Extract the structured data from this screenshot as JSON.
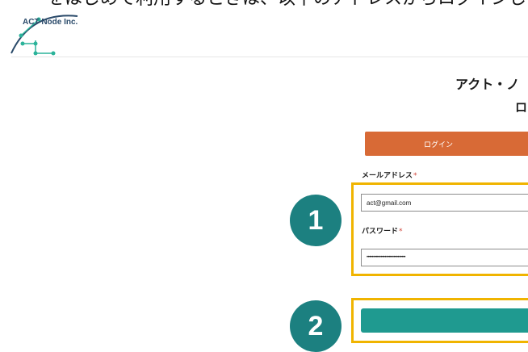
{
  "top_caption": "をはじめて利用するときは、以下のアドレスからログインします。",
  "header": {
    "logo_text": "ACT Node Inc."
  },
  "page": {
    "title_line1": "アクト・ノ",
    "title_line2": "ロ"
  },
  "tabs": {
    "login": "ログイン"
  },
  "form": {
    "email_label": "メールアドレス",
    "email_value": "act@gmail.com",
    "password_label": "パスワード",
    "password_value": "••••••••••••••••••••••••••••••",
    "required_mark": "*"
  },
  "annotations": {
    "step1": "1",
    "step2": "2"
  },
  "colors": {
    "accent_orange": "#d86a36",
    "teal": "#1c8080",
    "submit_teal": "#1f9a90",
    "highlight": "#f0b400"
  }
}
